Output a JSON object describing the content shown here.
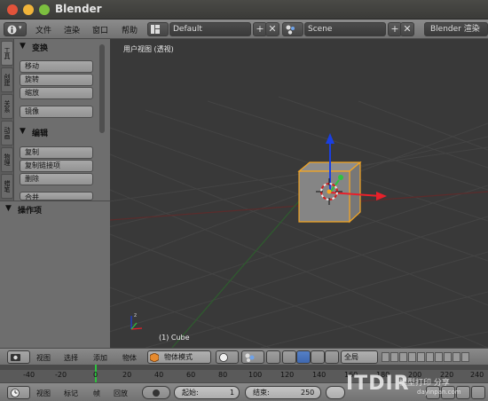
{
  "window": {
    "title": "Blender"
  },
  "info_header": {
    "menus": [
      "文件",
      "渲染",
      "窗口",
      "帮助"
    ],
    "screen_layout": "Default",
    "scene": "Scene",
    "render_engine": "Blender 渲染"
  },
  "toolshelf": {
    "tabs": [
      "工具",
      "创建",
      "关系",
      "动画",
      "物理",
      "蜡笔"
    ],
    "transform": {
      "header": "变换",
      "buttons": [
        "移动",
        "旋转",
        "缩放",
        "镜像"
      ]
    },
    "edit": {
      "header": "编辑",
      "buttons": [
        "复制",
        "复制链接项",
        "删除",
        "合并"
      ]
    },
    "operator_panel": "操作项"
  },
  "viewport": {
    "view_label": "用户视图 (透视)",
    "object_label": "(1) Cube"
  },
  "view3d_header": {
    "menus": [
      "视图",
      "选择",
      "添加",
      "物体"
    ],
    "mode": "物体模式",
    "orientation": "全局"
  },
  "timeline": {
    "ticks": [
      "-40",
      "-20",
      "0",
      "20",
      "40",
      "60",
      "80",
      "100",
      "120",
      "140",
      "160",
      "180",
      "200",
      "220",
      "240"
    ],
    "menus": [
      "视图",
      "标记",
      "帧",
      "回放"
    ],
    "start_label": "起始:",
    "start_value": "1",
    "end_label": "结束:",
    "end_value": "250"
  },
  "watermark": {
    "logo": "ITDIR",
    "text": "模型打印 分享",
    "url": "dayinpan.com"
  },
  "colors": {
    "accent": "#4c82d8",
    "selection": "#f5a623",
    "x_axis": "#e8202a",
    "y_axis": "#2ec23f",
    "z_axis": "#1a3fe0"
  },
  "icons": [
    "info-icon",
    "layout-icon",
    "scene-icon",
    "add-icon",
    "close-icon",
    "view3d-icon",
    "mode-cube-icon",
    "shading-sphere-icon",
    "pivot-icon",
    "manipulator-icon",
    "clock-icon"
  ]
}
